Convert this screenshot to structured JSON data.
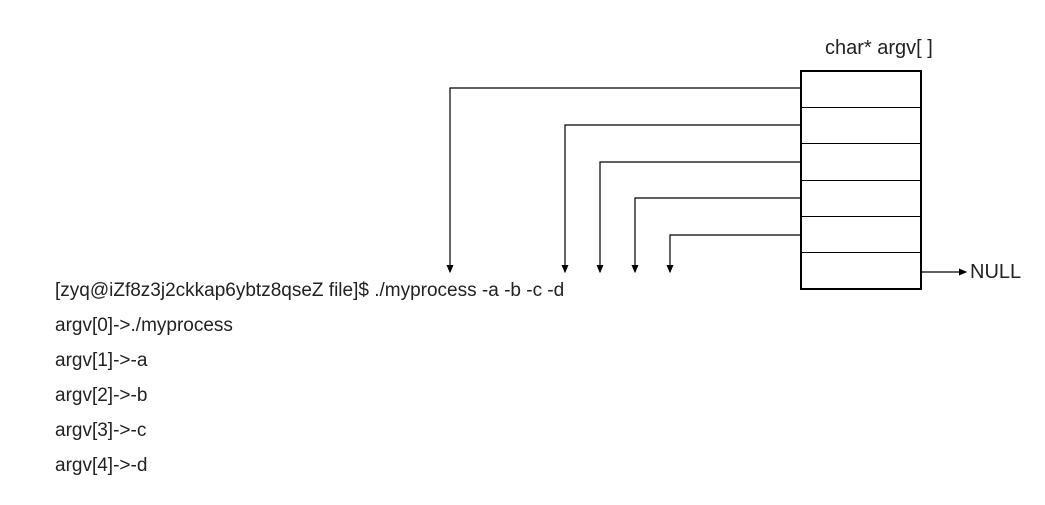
{
  "title_array": "char* argv[ ]",
  "null_label": "NULL",
  "command_line": "[zyq@iZf8z3j2ckkap6ybtz8qseZ file]$ ./myprocess -a -b -c -d",
  "argv_lines": [
    "argv[0]->./myprocess",
    "argv[1]->-a",
    "argv[2]->-b",
    "argv[3]->-c",
    "argv[4]->-d"
  ],
  "array_cells": 6
}
